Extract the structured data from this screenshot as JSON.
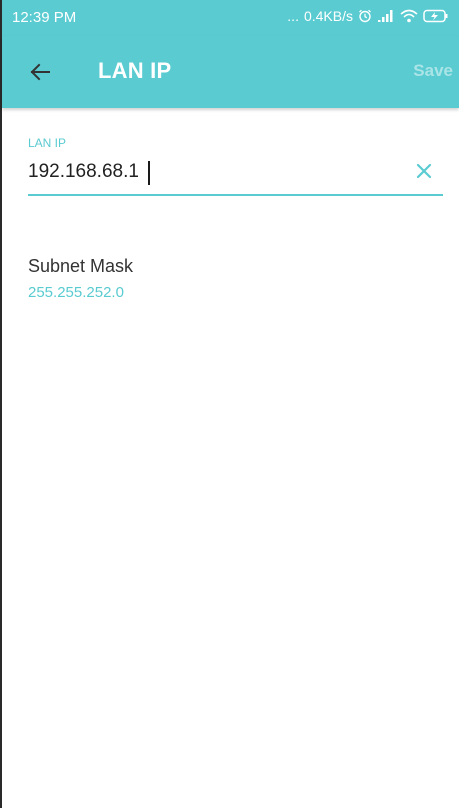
{
  "status_bar": {
    "time": "12:39 PM",
    "dots": "...",
    "speed": "0.4KB/s",
    "icons": [
      "alarm-icon",
      "signal-icon",
      "wifi-icon",
      "battery-charging-icon"
    ]
  },
  "app_bar": {
    "title": "LAN IP",
    "save_label": "Save",
    "back_icon": "arrow-left-icon"
  },
  "form": {
    "lan_ip_label": "LAN IP",
    "lan_ip_value": "192.168.68.1",
    "clear_icon": "close-icon",
    "subnet_label": "Subnet Mask",
    "subnet_value": "255.255.252.0"
  },
  "colors": {
    "accent": "#59cbd1",
    "save_disabled": "#a9e4e7",
    "text": "#333333"
  }
}
